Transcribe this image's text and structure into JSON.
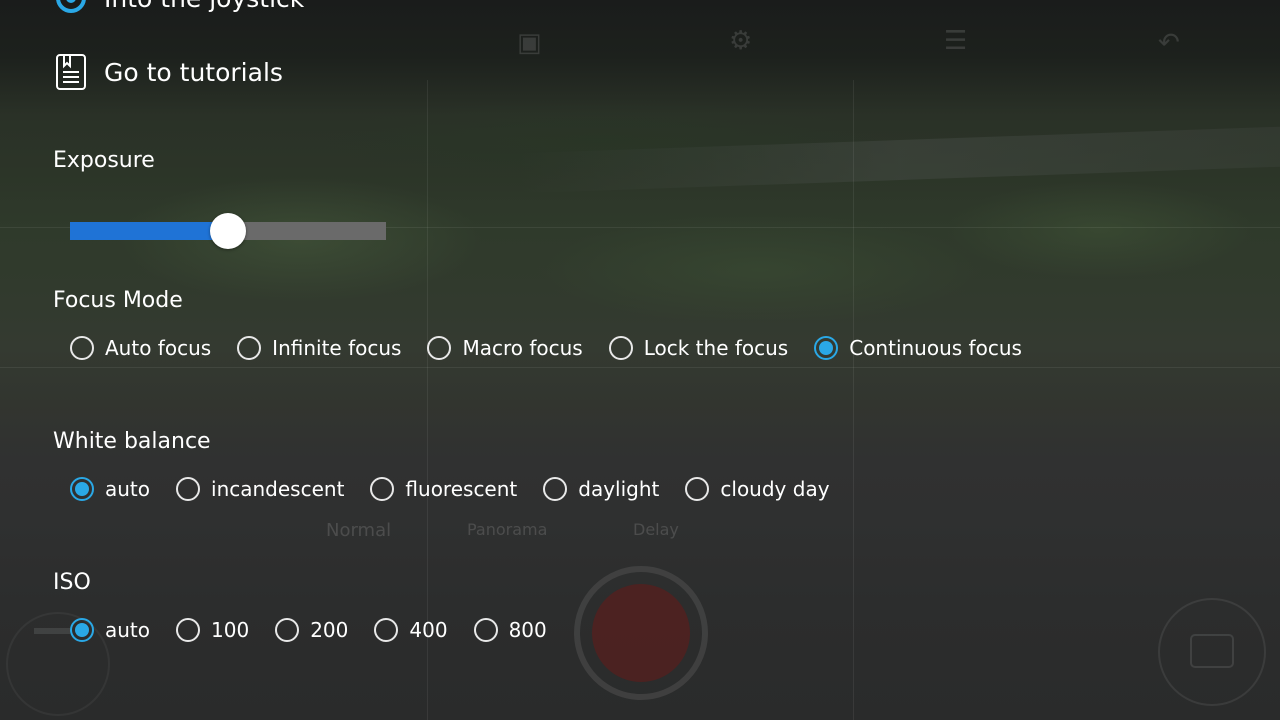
{
  "menu": {
    "joystick_label": "Into the joystick",
    "tutorials_label": "Go to tutorials"
  },
  "exposure": {
    "title": "Exposure",
    "level": 0.5
  },
  "focus_mode": {
    "title": "Focus Mode",
    "options": [
      "Auto focus",
      "Infinite focus",
      "Macro focus",
      "Lock the focus",
      "Continuous focus"
    ],
    "selected": "Continuous focus"
  },
  "white_balance": {
    "title": "White balance",
    "options": [
      "auto",
      "incandescent",
      "fluorescent",
      "daylight",
      "cloudy day"
    ],
    "selected": "auto"
  },
  "iso": {
    "title": "ISO",
    "options": [
      "auto",
      "100",
      "200",
      "400",
      "800"
    ],
    "selected": "auto"
  },
  "background": {
    "modes": [
      "Normal",
      "Panorama",
      "Delay"
    ]
  },
  "colors": {
    "accent": "#2aa8e6",
    "slider_fill": "#1f73d6",
    "slider_track": "#6a6a6a"
  }
}
